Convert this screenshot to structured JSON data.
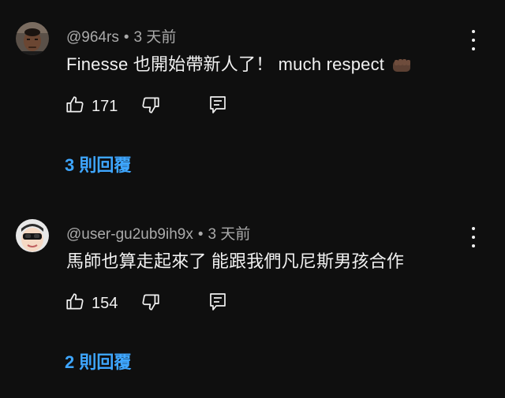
{
  "comments": [
    {
      "author": "@964rs",
      "time": "3 天前",
      "text": "Finesse 也開始帶新人了！ much respect",
      "emoji": "fist-emoji",
      "likes": "171",
      "replies": "3 則回覆"
    },
    {
      "author": "@user-gu2ub9ih9x",
      "time": "3 天前",
      "text": "馬師也算走起來了 能跟我們凡尼斯男孩合作",
      "likes": "154",
      "replies": "2 則回覆"
    }
  ],
  "separator": "•",
  "colors": {
    "background": "#0f0f0f",
    "text": "#f1f1f1",
    "meta": "#aaaaaa",
    "link": "#3ea6ff"
  }
}
